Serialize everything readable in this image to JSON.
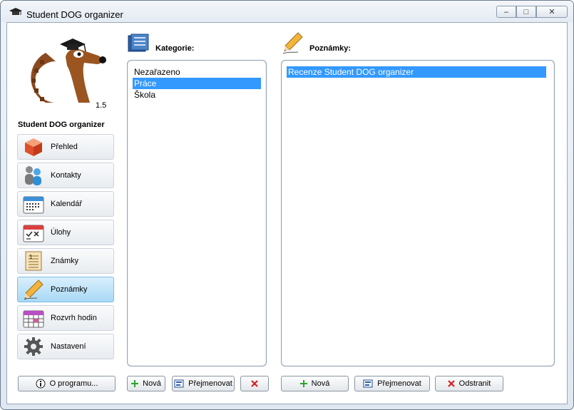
{
  "window": {
    "title": "Student DOG organizer",
    "minimize": "–",
    "maximize": "□",
    "close": "✕"
  },
  "logo": {
    "version": "1.5"
  },
  "sidebar": {
    "app_name": "Student DOG organizer",
    "items": [
      {
        "label": "Přehled",
        "icon": "cube-icon"
      },
      {
        "label": "Kontakty",
        "icon": "people-icon"
      },
      {
        "label": "Kalendář",
        "icon": "calendar-icon"
      },
      {
        "label": "Úlohy",
        "icon": "tasks-icon"
      },
      {
        "label": "Známky",
        "icon": "grades-icon"
      },
      {
        "label": "Poznámky",
        "icon": "pencil-icon",
        "active": true
      },
      {
        "label": "Rozvrh hodin",
        "icon": "timetable-icon"
      },
      {
        "label": "Nastavení",
        "icon": "gear-icon"
      }
    ],
    "about_button": "O programu..."
  },
  "categories": {
    "title": "Kategorie:",
    "items": [
      "Nezařazeno",
      "Práce",
      "Škola"
    ],
    "selected_index": 1,
    "buttons": {
      "new": "Nová",
      "rename": "Přejmenovat"
    }
  },
  "notes": {
    "title": "Poznámky:",
    "items": [
      "Recenze Student DOG organizer"
    ],
    "selected_index": 0,
    "buttons": {
      "new": "Nová",
      "rename": "Přejmenovat",
      "delete": "Odstranit"
    }
  },
  "colors": {
    "selection": "#3399ff",
    "active_nav": "#a8d8f6",
    "add_green": "#2aa52a",
    "delete_red": "#d42020"
  }
}
